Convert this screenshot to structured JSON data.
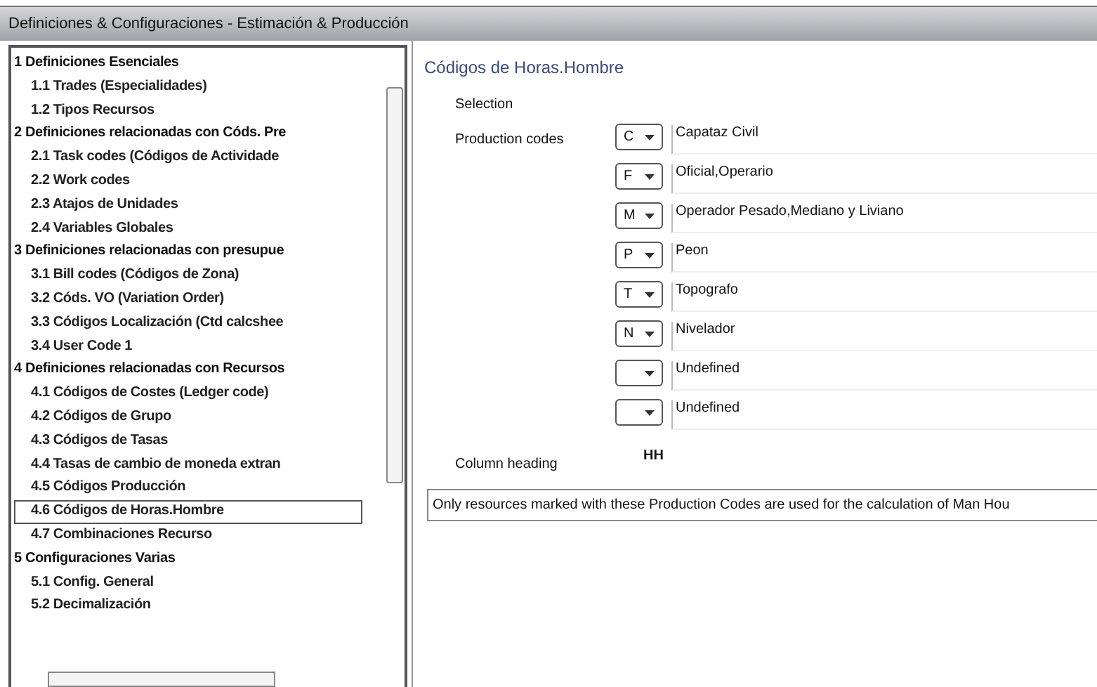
{
  "window": {
    "title": "Definiciones & Configuraciones - Estimación & Producción"
  },
  "tree": [
    {
      "label": "1 Definiciones Esenciales",
      "children": [
        {
          "label": "1.1  Trades (Especialidades)",
          "selected": false
        },
        {
          "label": "1.2  Tipos Recursos",
          "selected": false
        }
      ]
    },
    {
      "label": "2 Definiciones relacionadas con Códs. Pre",
      "children": [
        {
          "label": "2.1  Task codes (Códigos de Actividade",
          "selected": false
        },
        {
          "label": "2.2  Work codes",
          "selected": false
        },
        {
          "label": "2.3  Atajos de Unidades",
          "selected": false
        },
        {
          "label": "2.4  Variables Globales",
          "selected": false
        }
      ]
    },
    {
      "label": "3 Definiciones relacionadas con presupue",
      "children": [
        {
          "label": "3.1  Bill codes (Códigos de Zona)",
          "selected": false
        },
        {
          "label": "3.2  Códs. VO (Variation Order)",
          "selected": false
        },
        {
          "label": "3.3  Códigos Localización (Ctd calcshee",
          "selected": false
        },
        {
          "label": "3.4  User Code 1",
          "selected": false
        }
      ]
    },
    {
      "label": "4 Definiciones relacionadas con Recursos",
      "children": [
        {
          "label": "4.1  Códigos de Costes (Ledger code)",
          "selected": false
        },
        {
          "label": "4.2  Códigos de Grupo",
          "selected": false
        },
        {
          "label": "4.3  Códigos de Tasas",
          "selected": false
        },
        {
          "label": "4.4  Tasas de cambio de moneda extran",
          "selected": false
        },
        {
          "label": "4.5  Códigos Producción",
          "selected": false
        },
        {
          "label": "4.6  Códigos de Horas.Hombre",
          "selected": true
        },
        {
          "label": "4.7  Combinaciones Recurso",
          "selected": false
        }
      ]
    },
    {
      "label": "5 Configuraciones Varias",
      "children": [
        {
          "label": "5.1  Config. General",
          "selected": false
        },
        {
          "label": "5.2  Decimalización",
          "selected": false
        }
      ]
    }
  ],
  "panel": {
    "title": "Códigos de Horas.Hombre",
    "section": "Selection",
    "codes_label": "Production codes",
    "codes": [
      {
        "code": "C",
        "name": "Capataz Civil"
      },
      {
        "code": "F",
        "name": "Oficial,Operario"
      },
      {
        "code": "M",
        "name": "Operador Pesado,Mediano y Liviano"
      },
      {
        "code": "P",
        "name": "Peon"
      },
      {
        "code": "T",
        "name": "Topografo"
      },
      {
        "code": "N",
        "name": "Nivelador"
      },
      {
        "name": "Undefined"
      },
      {
        "name": "Undefined"
      }
    ],
    "column_heading_label": "Column heading",
    "column_heading": "HH",
    "note": "Only resources marked with these Production Codes are used for the calculation of Man Hou"
  }
}
